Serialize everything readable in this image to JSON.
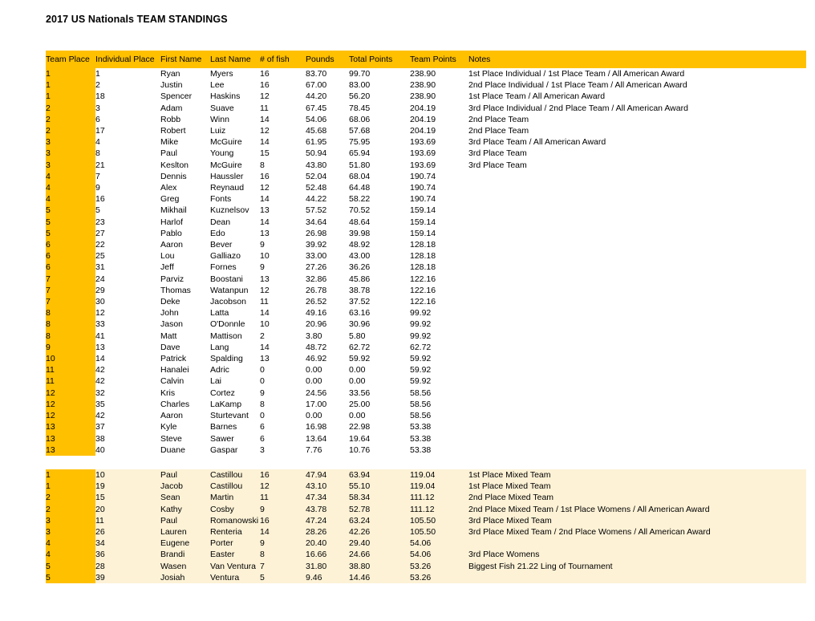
{
  "document": {
    "title": "2017 US Nationals TEAM STANDINGS"
  },
  "table": {
    "columns": [
      {
        "key": "team_place",
        "label": "Team Place"
      },
      {
        "key": "individual_place",
        "label": "Individual Place"
      },
      {
        "key": "first_name",
        "label": "First Name"
      },
      {
        "key": "last_name",
        "label": "Last Name"
      },
      {
        "key": "num_fish",
        "label": "# of fish"
      },
      {
        "key": "pounds",
        "label": "Pounds"
      },
      {
        "key": "total_points",
        "label": "Total Points"
      },
      {
        "key": "team_points",
        "label": "Team Points"
      },
      {
        "key": "notes",
        "label": "Notes"
      }
    ],
    "colors": {
      "header_background": "#ffc000",
      "team_place_background": "#ffc000",
      "mixed_section_background": "#fdf2d6",
      "page_background": "#ffffff",
      "text": "#000000"
    },
    "sections": [
      {
        "name": "open-standings",
        "rows": [
          [
            "1",
            "1",
            "Ryan",
            "Myers",
            "16",
            "83.70",
            "99.70",
            "238.90",
            "1st Place Individual / 1st Place Team / All American Award"
          ],
          [
            "1",
            "2",
            "Justin",
            "Lee",
            "16",
            "67.00",
            "83.00",
            "238.90",
            "2nd Place Individual / 1st Place Team / All American Award"
          ],
          [
            "1",
            "18",
            "Spencer",
            "Haskins",
            "12",
            "44.20",
            "56.20",
            "238.90",
            "1st Place Team / All American Award"
          ],
          [
            "2",
            "3",
            "Adam",
            "Suave",
            "11",
            "67.45",
            "78.45",
            "204.19",
            "3rd Place Individual / 2nd Place Team / All American Award"
          ],
          [
            "2",
            "6",
            "Robb",
            "Winn",
            "14",
            "54.06",
            "68.06",
            "204.19",
            "2nd Place Team"
          ],
          [
            "2",
            "17",
            "Robert",
            "Luiz",
            "12",
            "45.68",
            "57.68",
            "204.19",
            "2nd Place Team"
          ],
          [
            "3",
            "4",
            "Mike",
            "McGuire",
            "14",
            "61.95",
            "75.95",
            "193.69",
            "3rd Place Team / All American Award"
          ],
          [
            "3",
            "8",
            "Paul",
            "Young",
            "15",
            "50.94",
            "65.94",
            "193.69",
            "3rd Place Team"
          ],
          [
            "3",
            "21",
            "Keslton",
            "McGuire",
            "8",
            "43.80",
            "51.80",
            "193.69",
            "3rd Place Team"
          ],
          [
            "4",
            "7",
            "Dennis",
            "Haussler",
            "16",
            "52.04",
            "68.04",
            "190.74",
            ""
          ],
          [
            "4",
            "9",
            "Alex",
            "Reynaud",
            "12",
            "52.48",
            "64.48",
            "190.74",
            ""
          ],
          [
            "4",
            "16",
            "Greg",
            "Fonts",
            "14",
            "44.22",
            "58.22",
            "190.74",
            ""
          ],
          [
            "5",
            "5",
            "Mikhail",
            "Kuznelsov",
            "13",
            "57.52",
            "70.52",
            "159.14",
            ""
          ],
          [
            "5",
            "23",
            "Harlof",
            "Dean",
            "14",
            "34.64",
            "48.64",
            "159.14",
            ""
          ],
          [
            "5",
            "27",
            "Pablo",
            "Edo",
            "13",
            "26.98",
            "39.98",
            "159.14",
            ""
          ],
          [
            "6",
            "22",
            "Aaron",
            "Bever",
            "9",
            "39.92",
            "48.92",
            "128.18",
            ""
          ],
          [
            "6",
            "25",
            "Lou",
            "Galliazo",
            "10",
            "33.00",
            "43.00",
            "128.18",
            ""
          ],
          [
            "6",
            "31",
            "Jeff",
            "Fornes",
            "9",
            "27.26",
            "36.26",
            "128.18",
            ""
          ],
          [
            "7",
            "24",
            "Parviz",
            "Boostani",
            "13",
            "32.86",
            "45.86",
            "122.16",
            ""
          ],
          [
            "7",
            "29",
            "Thomas",
            "Watanpun",
            "12",
            "26.78",
            "38.78",
            "122.16",
            ""
          ],
          [
            "7",
            "30",
            "Deke",
            "Jacobson",
            "11",
            "26.52",
            "37.52",
            "122.16",
            ""
          ],
          [
            "8",
            "12",
            "John",
            "Latta",
            "14",
            "49.16",
            "63.16",
            "99.92",
            ""
          ],
          [
            "8",
            "33",
            "Jason",
            "O'Donnle",
            "10",
            "20.96",
            "30.96",
            "99.92",
            ""
          ],
          [
            "8",
            "41",
            "Matt",
            "Mattison",
            "2",
            "3.80",
            "5.80",
            "99.92",
            ""
          ],
          [
            "9",
            "13",
            "Dave",
            "Lang",
            "14",
            "48.72",
            "62.72",
            "62.72",
            ""
          ],
          [
            "10",
            "14",
            "Patrick",
            "Spalding",
            "13",
            "46.92",
            "59.92",
            "59.92",
            ""
          ],
          [
            "11",
            "42",
            "Hanalei",
            "Adric",
            "0",
            "0.00",
            "0.00",
            "59.92",
            ""
          ],
          [
            "11",
            "42",
            "Calvin",
            "Lai",
            "0",
            "0.00",
            "0.00",
            "59.92",
            ""
          ],
          [
            "12",
            "32",
            "Kris",
            "Cortez",
            "9",
            "24.56",
            "33.56",
            "58.56",
            ""
          ],
          [
            "12",
            "35",
            "Charles",
            "LaKamp",
            "8",
            "17.00",
            "25.00",
            "58.56",
            ""
          ],
          [
            "12",
            "42",
            "Aaron",
            "Sturtevant",
            "0",
            "0.00",
            "0.00",
            "58.56",
            ""
          ],
          [
            "13",
            "37",
            "Kyle",
            "Barnes",
            "6",
            "16.98",
            "22.98",
            "53.38",
            ""
          ],
          [
            "13",
            "38",
            "Steve",
            "Sawer",
            "6",
            "13.64",
            "19.64",
            "53.38",
            ""
          ],
          [
            "13",
            "40",
            "Duane",
            "Gaspar",
            "3",
            "7.76",
            "10.76",
            "53.38",
            ""
          ]
        ]
      },
      {
        "name": "mixed-team-standings",
        "rows": [
          [
            "1",
            "10",
            "Paul",
            "Castillou",
            "16",
            "47.94",
            "63.94",
            "119.04",
            "1st Place Mixed Team"
          ],
          [
            "1",
            "19",
            "Jacob",
            "Castillou",
            "12",
            "43.10",
            "55.10",
            "119.04",
            "1st Place Mixed Team"
          ],
          [
            "2",
            "15",
            "Sean",
            "Martin",
            "11",
            "47.34",
            "58.34",
            "111.12",
            "2nd Place Mixed Team"
          ],
          [
            "2",
            "20",
            "Kathy",
            "Cosby",
            "9",
            "43.78",
            "52.78",
            "111.12",
            "2nd Place Mixed Team / 1st Place Womens / All American Award"
          ],
          [
            "3",
            "11",
            "Paul",
            "Romanowski",
            "16",
            "47.24",
            "63.24",
            "105.50",
            "3rd Place Mixed Team"
          ],
          [
            "3",
            "26",
            "Lauren",
            "Renteria",
            "14",
            "28.26",
            "42.26",
            "105.50",
            "3rd Place Mixed Team / 2nd Place Womens / All American Award"
          ],
          [
            "4",
            "34",
            "Eugene",
            "Porter",
            "9",
            "20.40",
            "29.40",
            "54.06",
            ""
          ],
          [
            "4",
            "36",
            "Brandi",
            "Easter",
            "8",
            "16.66",
            "24.66",
            "54.06",
            "3rd Place Womens"
          ],
          [
            "5",
            "28",
            "Wasen",
            "Van Ventura",
            "7",
            "31.80",
            "38.80",
            "53.26",
            "Biggest Fish 21.22 Ling of Tournament"
          ],
          [
            "5",
            "39",
            "Josiah",
            "Ventura",
            "5",
            "9.46",
            "14.46",
            "53.26",
            ""
          ]
        ]
      }
    ]
  }
}
